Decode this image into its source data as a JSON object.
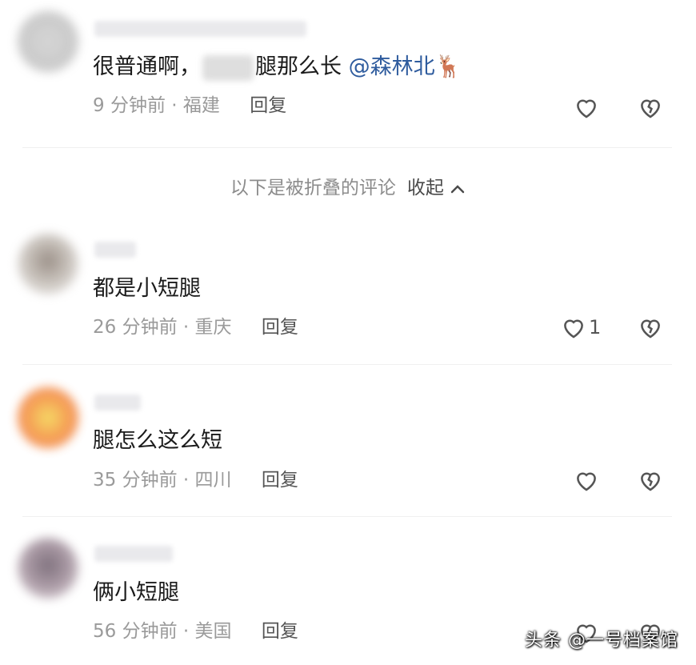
{
  "comments": [
    {
      "text_before": "很普通啊，",
      "text_after": "腿那么长",
      "mention": "@森林北",
      "emoji": "🦌",
      "time": "9 分钟前",
      "location": "福建",
      "reply": "回复",
      "likes": ""
    },
    {
      "text": "都是小短腿",
      "time": "26 分钟前",
      "location": "重庆",
      "reply": "回复",
      "likes": "1"
    },
    {
      "text": "腿怎么这么短",
      "time": "35 分钟前",
      "location": "四川",
      "reply": "回复",
      "likes": ""
    },
    {
      "text": "俩小短腿",
      "time": "56 分钟前",
      "location": "美国",
      "reply": "回复",
      "likes": ""
    }
  ],
  "fold": {
    "label": "以下是被折叠的评论",
    "collapse": "收起",
    "collapse_icon": "chevron-up-icon"
  },
  "watermark": "头条 @一号档案馆",
  "colors": {
    "mention": "#2f5c9e",
    "meta": "#9a9a9a",
    "icon": "#555555"
  }
}
